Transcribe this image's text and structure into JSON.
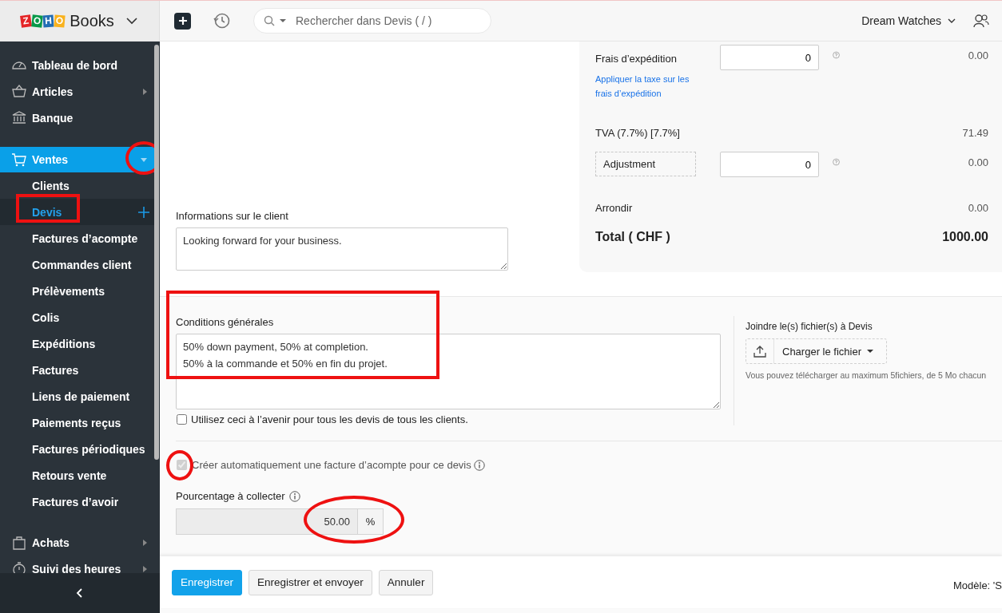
{
  "app": {
    "logo_tiles": [
      {
        "letter": "Z",
        "color": "#e42527"
      },
      {
        "letter": "O",
        "color": "#089949"
      },
      {
        "letter": "H",
        "color": "#226db4"
      },
      {
        "letter": "O",
        "color": "#f9b21d"
      }
    ],
    "product": "Books"
  },
  "top_bar": {
    "search": {
      "placeholder": "Rechercher dans Devis ( / )"
    },
    "organization": "Dream Watches"
  },
  "sidebar": {
    "items": [
      {
        "label": "Tableau de bord",
        "has_arrow": false,
        "selected": false
      },
      {
        "label": "Articles",
        "has_arrow": true,
        "selected": false
      },
      {
        "label": "Banque",
        "has_arrow": false,
        "selected": false
      },
      {
        "label": "Ventes",
        "has_arrow": true,
        "selected": true,
        "expanded": true,
        "annotated": true,
        "children": [
          {
            "label": "Clients",
            "selected": false
          },
          {
            "label": "Devis",
            "selected": true,
            "annotated": true
          },
          {
            "label": "Factures d’acompte",
            "selected": false
          },
          {
            "label": "Commandes client",
            "selected": false
          },
          {
            "label": "Prélèvements",
            "selected": false
          },
          {
            "label": "Colis",
            "selected": false
          },
          {
            "label": "Expéditions",
            "selected": false
          },
          {
            "label": "Factures",
            "selected": false
          },
          {
            "label": "Liens de paiement",
            "selected": false
          },
          {
            "label": "Paiements reçus",
            "selected": false
          },
          {
            "label": "Factures périodiques",
            "selected": false
          },
          {
            "label": "Retours vente",
            "selected": false
          },
          {
            "label": "Factures d’avoir",
            "selected": false
          }
        ]
      },
      {
        "label": "Achats",
        "has_arrow": true,
        "selected": false
      },
      {
        "label": "Suivi des heures",
        "has_arrow": true,
        "selected": false
      }
    ]
  },
  "totals": {
    "rows": [
      {
        "kind": "input",
        "label": "Frais d’expédition",
        "link": "Appliquer la taxe sur les frais d’expédition",
        "value": "0",
        "amount": "0.00"
      },
      {
        "kind": "text",
        "label": "TVA (7.7%) [7.7%]",
        "amount": "71.49"
      },
      {
        "kind": "editable",
        "label": "Adjustment",
        "value": "0",
        "amount": "0.00"
      },
      {
        "kind": "text",
        "label": "Arrondir",
        "amount": "0.00"
      },
      {
        "kind": "total",
        "label": "Total ( CHF )",
        "amount": "1000.00"
      }
    ]
  },
  "customer_notes": {
    "label": "Informations sur le client",
    "value": "Looking forward for your business."
  },
  "terms": {
    "label": "Conditions générales",
    "value": "50% down payment, 50% at completion.\n50% à la commande et 50% en fin du projet.",
    "annotated": true,
    "reuse_checkbox": {
      "label": "Utilisez ceci à l’avenir pour tous les devis de tous les clients.",
      "checked": false
    }
  },
  "attachments": {
    "label": "Joindre le(s) fichier(s) à Devis",
    "button": "Charger le fichier",
    "hint": "Vous pouvez télécharger au maximum 5fichiers, de 5 Mo chacun"
  },
  "auto_invoice": {
    "label": "Créer automatiquement une facture d’acompte pour ce devis",
    "checked": true,
    "disabled": true,
    "annotated": true
  },
  "percentage": {
    "label": "Pourcentage à collecter",
    "value": "50.00",
    "unit": "%",
    "annotated": true
  },
  "footer": {
    "buttons": [
      {
        "label": "Enregistrer",
        "kind": "primary"
      },
      {
        "label": "Enregistrer et envoyer",
        "kind": "secondary"
      },
      {
        "label": "Annuler",
        "kind": "secondary"
      }
    ],
    "template": "Modèle: 'S"
  }
}
